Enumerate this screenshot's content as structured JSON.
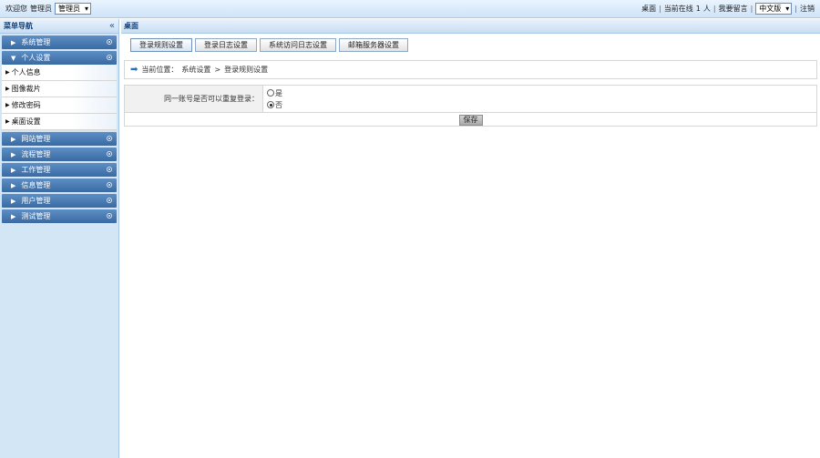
{
  "topbar": {
    "welcome": "欢迎您",
    "user": "管理员",
    "role_select": "管理员",
    "desktop": "桌面",
    "online_prefix": "当前在线",
    "online_count": "1",
    "online_unit": "人",
    "message": "我要留言",
    "language_select": "中文版",
    "logout": "注销"
  },
  "sidebar": {
    "title": "菜单导航",
    "collapse_symbol": "«",
    "menus": [
      {
        "label": "系统管理"
      },
      {
        "label": "个人设置",
        "expanded": true
      },
      {
        "label": "网站管理"
      },
      {
        "label": "流程管理"
      },
      {
        "label": "工作管理"
      },
      {
        "label": "信息管理"
      },
      {
        "label": "用户管理"
      },
      {
        "label": "测试管理"
      }
    ],
    "submenu": [
      "个人信息",
      "图像裁片",
      "修改密码",
      "桌面设置"
    ]
  },
  "main": {
    "title": "桌面",
    "tabs": [
      "登录规则设置",
      "登录日志设置",
      "系统访问日志设置",
      "邮箱服务器设置"
    ],
    "active_tab": 0,
    "breadcrumb": {
      "prefix": "当前位置：",
      "part1": "系统设置",
      "sep": ">",
      "part2": "登录规则设置"
    },
    "form": {
      "label": "同一账号是否可以重复登录：",
      "option_yes": "是",
      "option_no": "否",
      "selected": "否",
      "save_label": "保存"
    }
  },
  "colors": {
    "menu_bar": "#3a6aa3",
    "sidebar_bg": "#d3e6f6",
    "header_bg": "#cfe3f8"
  }
}
